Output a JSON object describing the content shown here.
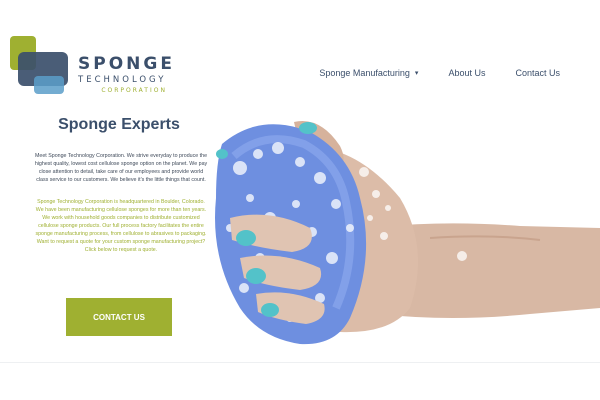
{
  "logo": {
    "line1": "SPONGE",
    "line2": "TECHNOLOGY",
    "line3": "CORPORATION",
    "colors": {
      "navy": "#3b4f6b",
      "green": "#9fb031",
      "blue": "#5b9ec9"
    }
  },
  "nav": {
    "items": [
      {
        "label": "Sponge Manufacturing",
        "has_dropdown": true
      },
      {
        "label": "About Us"
      },
      {
        "label": "Contact Us"
      }
    ]
  },
  "hero": {
    "title": "Sponge Experts",
    "paragraph1": "Meet Sponge Technology Corporation. We strive everyday to produce the highest quality, lowest cost cellulose sponge option on the planet. We pay close attention to detail, take care of our employees and provide world class service to our customers. We believe it's the little things that count.",
    "paragraph2": "Sponge Technology Corporation is headquartered in Boulder, Colorado. We have been manufacturing cellulose sponges for more than ten years. We work with household goods companies to distribute customized cellulose sponge products. Our full process factory facilitates the entire sponge manufacturing process, from cellulose to abrasives to packaging. Want to request a quote for your custom sponge manufacturing project? Click below to request a quote.",
    "cta_label": "CONTACT US"
  },
  "colors": {
    "accent_green": "#9fb031",
    "navy_text": "#3b4f6b",
    "sponge_blue": "#6e8fe0"
  }
}
